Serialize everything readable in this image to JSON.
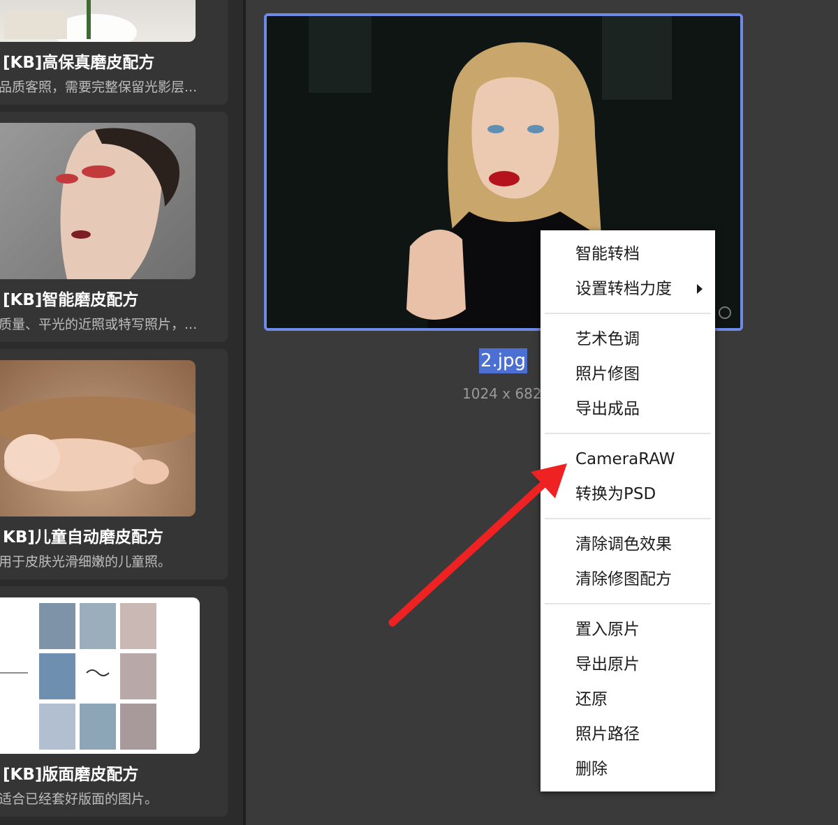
{
  "presets": [
    {
      "title": "[KB]高保真磨皮配方",
      "description": "品质客照，需要完整保留光影层..."
    },
    {
      "title": "[KB]智能磨皮配方",
      "description": "质量、平光的近照或特写照片，..."
    },
    {
      "title": "KB]儿童自动磨皮配方",
      "description": "用于皮肤光滑细嫩的儿童照。"
    },
    {
      "title": "[KB]版面磨皮配方",
      "description": "适合已经套好版面的图片。"
    }
  ],
  "photo": {
    "name": "2.jpg",
    "dimensions": "1024 x 682"
  },
  "context_menu": {
    "items": [
      "智能转档",
      "设置转档力度",
      "艺术色调",
      "照片修图",
      "导出成品",
      "CameraRAW",
      "转换为PSD",
      "清除调色效果",
      "清除修图配方",
      "置入原片",
      "导出原片",
      "还原",
      "照片路径",
      "删除"
    ]
  },
  "colors": {
    "selection_border": "#6d8ae6",
    "name_highlight": "#4c6fd4",
    "annotation_arrow": "#ee2222"
  }
}
